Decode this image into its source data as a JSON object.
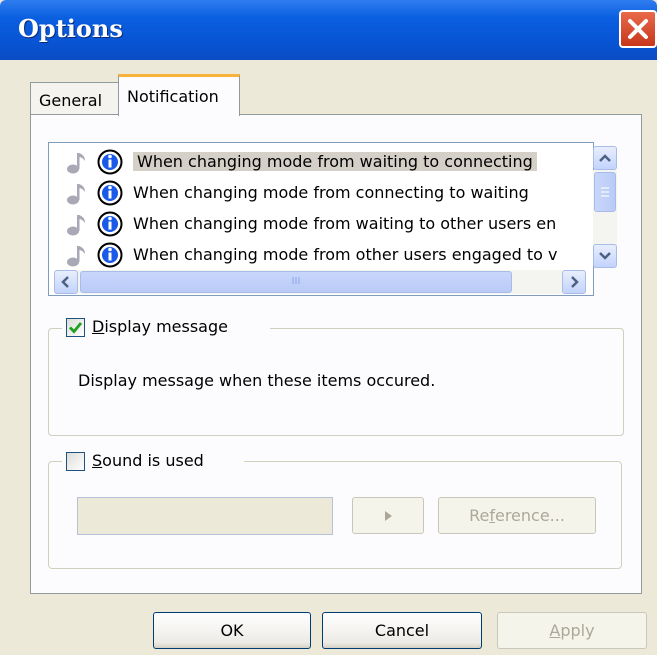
{
  "window": {
    "title": "Options"
  },
  "tabs": [
    {
      "label": "General",
      "active": false
    },
    {
      "label": "Notification",
      "active": true
    }
  ],
  "event_list": {
    "items": [
      {
        "label": "When changing mode from waiting to connecting",
        "selected": true,
        "icons": [
          "note-icon",
          "info-icon"
        ]
      },
      {
        "label": "When changing mode from connecting to waiting",
        "selected": false,
        "icons": [
          "note-icon",
          "info-icon"
        ]
      },
      {
        "label": "When changing mode from waiting to other users en",
        "selected": false,
        "icons": [
          "note-icon",
          "info-icon"
        ]
      },
      {
        "label": "When changing mode from other users engaged to v",
        "selected": false,
        "icons": [
          "note-icon",
          "info-icon"
        ]
      }
    ],
    "horizontal_thumb_grip": "III"
  },
  "display_group": {
    "checkbox_label": "Display message",
    "checkbox_accel": "D",
    "checkbox_rest": "isplay message",
    "checked": true,
    "description": "Display message when these items occured."
  },
  "sound_group": {
    "checkbox_label": "Sound is used",
    "checkbox_accel": "S",
    "checkbox_rest": "ound is used",
    "checked": false,
    "sound_file_value": "",
    "reference_button": "Reference...",
    "reference_pre": "Re",
    "reference_accel": "f",
    "reference_post": "erence..."
  },
  "buttons": {
    "ok": "OK",
    "cancel": "Cancel",
    "apply": "Apply",
    "apply_accel": "A",
    "apply_rest": "pply"
  },
  "colors": {
    "titlebar": "#0a5fe0",
    "tab_highlight": "#f7b33b",
    "close_button": "#c8361b",
    "checkmark": "#21a121",
    "selection": "#d4d0c8"
  }
}
